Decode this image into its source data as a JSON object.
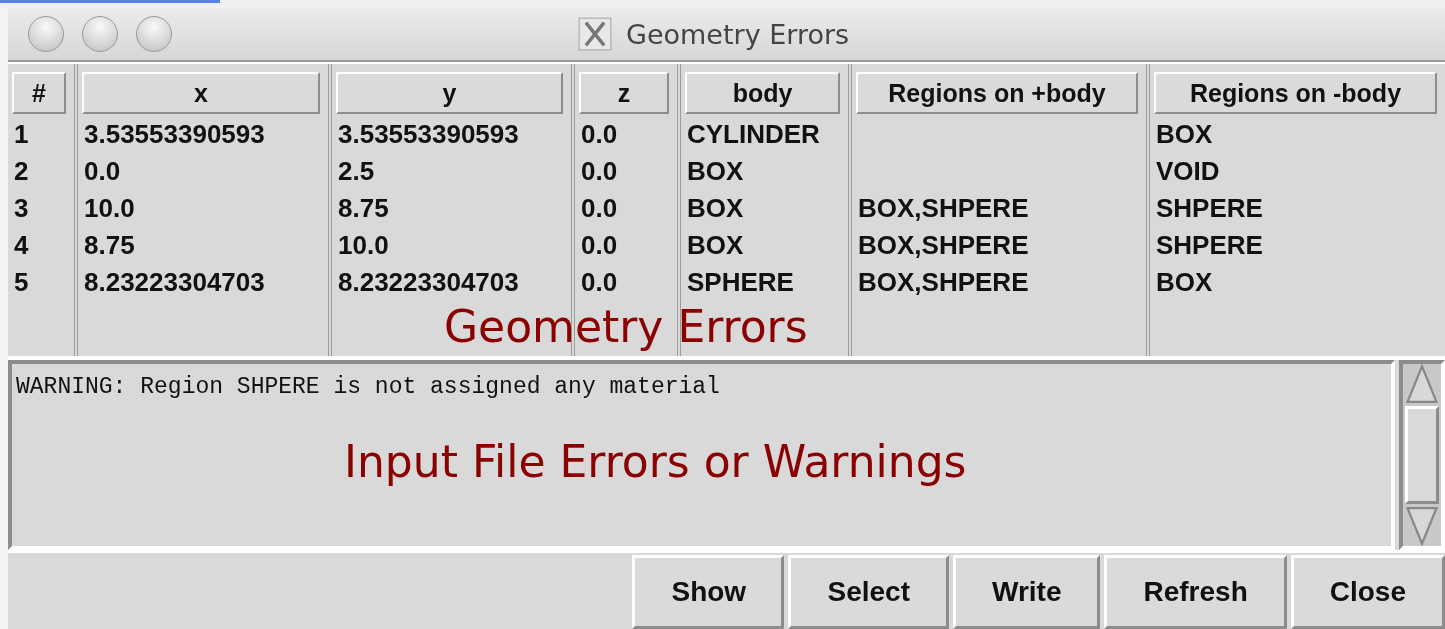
{
  "window": {
    "title": "Geometry Errors"
  },
  "table": {
    "columns": [
      "#",
      "x",
      "y",
      "z",
      "body",
      "Regions on +body",
      "Regions on -body"
    ],
    "rows": [
      [
        "1",
        "3.53553390593",
        "3.53553390593",
        "0.0",
        "CYLINDER",
        "",
        "BOX"
      ],
      [
        "2",
        "0.0",
        "2.5",
        "0.0",
        "BOX",
        "",
        "VOID"
      ],
      [
        "3",
        "10.0",
        "8.75",
        "0.0",
        "BOX",
        "BOX,SHPERE",
        "SHPERE"
      ],
      [
        "4",
        "8.75",
        "10.0",
        "0.0",
        "BOX",
        "BOX,SHPERE",
        "SHPERE"
      ],
      [
        "5",
        "8.23223304703",
        "8.23223304703",
        "0.0",
        "SPHERE",
        "BOX,SHPERE",
        "BOX"
      ]
    ]
  },
  "messages": {
    "lines": [
      "WARNING: Region SHPERE is not assigned any material"
    ]
  },
  "buttons": [
    "Show",
    "Select",
    "Write",
    "Refresh",
    "Close"
  ],
  "annotations": [
    {
      "kind": "table",
      "text": "Geometry Errors"
    },
    {
      "kind": "messages",
      "text": "Input File Errors or Warnings"
    }
  ]
}
